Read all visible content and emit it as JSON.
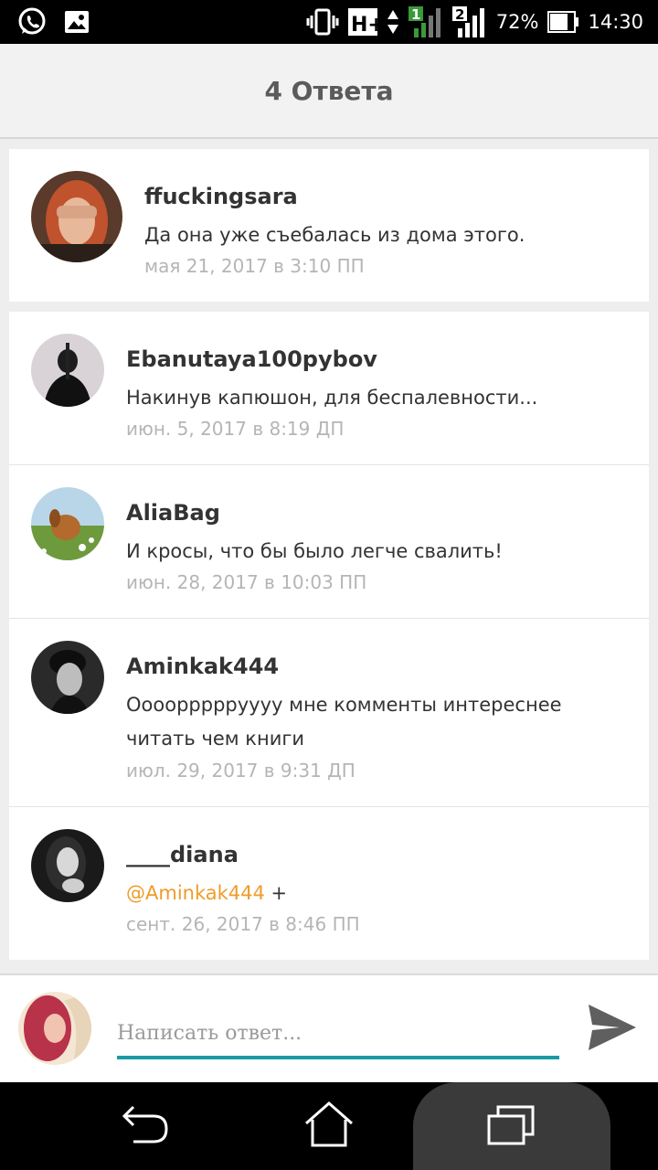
{
  "status_bar": {
    "battery": "72%",
    "time": "14:30",
    "network": "H+",
    "sim2": "2",
    "sim1": "1",
    "icons": [
      "whatsapp-icon",
      "image-icon",
      "vibrate-icon",
      "network-icon",
      "signal-icon",
      "battery-icon"
    ]
  },
  "header": {
    "title": "4 Ответа"
  },
  "original_comment": {
    "author": "ffuckingsara",
    "text": "Да она уже съебалась из дома этого.",
    "time": "мая 21, 2017 в 3:10 ПП"
  },
  "replies": [
    {
      "author": "Ebanutaya100pybov",
      "text": "Накинув капюшон, для беспалевности...",
      "time": "июн. 5, 2017 в 8:19 ДП"
    },
    {
      "author": "AliaBag",
      "text": "И кросы, что бы было легче свалить!",
      "time": "июн. 28, 2017 в 10:03 ПП"
    },
    {
      "author": "Aminkak444",
      "text_line1": "Оооорррррyyyy мне комменты интереснее",
      "text_line2": "читать чем книги",
      "time": "июл. 29, 2017 в 9:31 ДП"
    },
    {
      "author": "____diana",
      "mention": "@Aminkak444",
      "text": " +",
      "time": "сент. 26, 2017 в 8:46 ПП"
    }
  ],
  "reply_bar": {
    "placeholder": "Написать ответ..."
  },
  "colors": {
    "accent_underline": "#1a9aa6",
    "mention": "#ef9c2a",
    "timestamp": "#b5b5b5"
  }
}
